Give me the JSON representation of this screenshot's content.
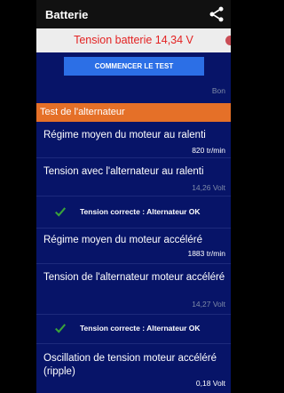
{
  "appbar": {
    "title": "Batterie",
    "share_icon": "share-icon"
  },
  "banner": {
    "voltage_text": "Tension batterie 14,34 V",
    "text_color": "#e32222"
  },
  "test_button": {
    "label": "COMMENCER LE TEST",
    "color": "#2c6fe6"
  },
  "battery_status": "Bon",
  "section": {
    "title": "Test de l'alternateur",
    "color": "#e57028"
  },
  "items": [
    {
      "label": "Régime moyen du moteur au ralenti",
      "value": "820 tr/min"
    },
    {
      "label": "Tension avec l'alternateur au ralenti",
      "value": "14,26 Volt"
    },
    {
      "label": "Régime moyen du moteur accéléré",
      "value": "1883 tr/min"
    },
    {
      "label": "Tension de l'alternateur moteur accéléré",
      "value": "14,27 Volt"
    },
    {
      "label": "Oscillation de tension moteur accéléré (ripple)",
      "value": "0,18 Volt"
    }
  ],
  "results": [
    {
      "text": "Tension correcte : Alternateur OK",
      "icon": "check-icon",
      "color": "#3aa33a"
    },
    {
      "text": "Tension correcte : Alternateur OK",
      "icon": "check-icon",
      "color": "#3aa33a"
    }
  ]
}
